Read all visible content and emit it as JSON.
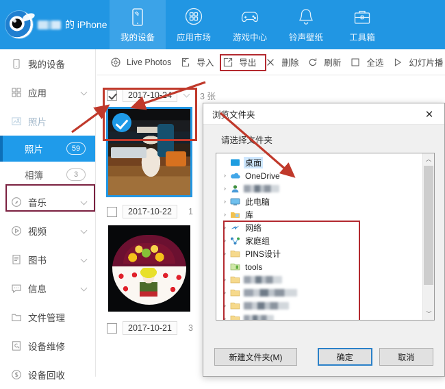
{
  "app": {
    "device_label": "的 iPhone",
    "device_caret": "▾",
    "logo_name": "i4tools-eye-logo"
  },
  "nav": {
    "tabs": [
      {
        "label": "我的设备",
        "icon": "device-icon",
        "active": true
      },
      {
        "label": "应用市场",
        "icon": "appstore-icon",
        "active": false
      },
      {
        "label": "游戏中心",
        "icon": "gamepad-icon",
        "active": false
      },
      {
        "label": "铃声壁纸",
        "icon": "bell-icon",
        "active": false
      },
      {
        "label": "工具箱",
        "icon": "toolbox-icon",
        "active": false
      }
    ]
  },
  "sidebar": {
    "items": [
      {
        "label": "我的设备",
        "icon": "phone-icon",
        "chevron": false
      },
      {
        "label": "应用",
        "icon": "apps-icon",
        "chevron": true
      },
      {
        "label": "照片",
        "icon": "image-icon",
        "chevron": false,
        "muted": true
      },
      {
        "label": "音乐",
        "icon": "music-icon",
        "chevron": true
      },
      {
        "label": "视频",
        "icon": "video-icon",
        "chevron": true
      },
      {
        "label": "图书",
        "icon": "book-icon",
        "chevron": true
      },
      {
        "label": "信息",
        "icon": "message-icon",
        "chevron": true
      },
      {
        "label": "文件管理",
        "icon": "folder-icon",
        "chevron": false
      },
      {
        "label": "设备维修",
        "icon": "repair-icon",
        "chevron": false
      },
      {
        "label": "设备回收",
        "icon": "recycle-icon",
        "chevron": false
      }
    ],
    "sub_items": [
      {
        "label": "照片",
        "badge": "59",
        "selected": true
      },
      {
        "label": "相簿",
        "badge": "3",
        "selected": false
      }
    ]
  },
  "toolbar": {
    "items": [
      {
        "label": "Live Photos",
        "icon": "livephoto-icon"
      },
      {
        "label": "导入",
        "icon": "import-icon"
      },
      {
        "label": "导出",
        "icon": "export-icon",
        "highlighted": true
      },
      {
        "label": "删除",
        "icon": "delete-icon"
      },
      {
        "label": "刷新",
        "icon": "refresh-icon"
      },
      {
        "label": "全选",
        "icon": "selectall-icon"
      },
      {
        "label": "幻灯片播",
        "icon": "slideshow-icon"
      }
    ]
  },
  "photo_groups": [
    {
      "date": "2017-10-24",
      "count": "3 张",
      "checked": true,
      "photo": "bottle",
      "photo_selected": true
    },
    {
      "date": "2017-10-22",
      "count": "1",
      "checked": false,
      "photo": "cake",
      "photo_selected": false
    },
    {
      "date": "2017-10-21",
      "count": "3",
      "checked": false,
      "photo": null,
      "photo_selected": false
    }
  ],
  "dialog": {
    "title": "浏览文件夹",
    "close_glyph": "✕",
    "prompt": "请选择文件夹",
    "tree": [
      {
        "label": "桌面",
        "icon": "desktop-icon",
        "expander": "",
        "selected": true,
        "indent": 0,
        "blurred": false
      },
      {
        "label": "OneDrive",
        "icon": "onedrive-icon",
        "expander": "›",
        "selected": false,
        "indent": 1,
        "blurred": false
      },
      {
        "label": "",
        "icon": "user-icon",
        "expander": "›",
        "selected": false,
        "indent": 1,
        "blurred": true,
        "blur_width": 52
      },
      {
        "label": "此电脑",
        "icon": "computer-icon",
        "expander": "›",
        "selected": false,
        "indent": 1,
        "blurred": false
      },
      {
        "label": "库",
        "icon": "library-icon",
        "expander": "›",
        "selected": false,
        "indent": 1,
        "blurred": false
      },
      {
        "label": "网络",
        "icon": "network-icon",
        "expander": "›",
        "selected": false,
        "indent": 1,
        "blurred": false
      },
      {
        "label": "家庭组",
        "icon": "homegroup-icon",
        "expander": "›",
        "selected": false,
        "indent": 1,
        "blurred": false
      },
      {
        "label": "PINS设计",
        "icon": "folder-icon",
        "expander": "›",
        "selected": false,
        "indent": 1,
        "blurred": false
      },
      {
        "label": "tools",
        "icon": "folder-green-icon",
        "expander": "",
        "selected": false,
        "indent": 1,
        "blurred": false
      },
      {
        "label": "",
        "icon": "folder-icon",
        "expander": "›",
        "selected": false,
        "indent": 1,
        "blurred": true,
        "blur_width": 56
      },
      {
        "label": "",
        "icon": "folder-icon",
        "expander": "›",
        "selected": false,
        "indent": 1,
        "blurred": true,
        "blur_width": 78
      },
      {
        "label": "",
        "icon": "folder-icon",
        "expander": "›",
        "selected": false,
        "indent": 1,
        "blurred": true,
        "blur_width": 66
      },
      {
        "label": "",
        "icon": "folder-icon",
        "expander": "›",
        "selected": false,
        "indent": 1,
        "blurred": true,
        "blur_width": 44
      }
    ],
    "scroll_up": "︿",
    "scroll_down": "﹀",
    "buttons": {
      "new_folder": "新建文件夹(M)",
      "ok": "确定",
      "cancel": "取消"
    }
  },
  "annotations": {
    "accent_red": "#c0392b",
    "box_red": "#b3292f",
    "box_purple": "#7a2040"
  }
}
